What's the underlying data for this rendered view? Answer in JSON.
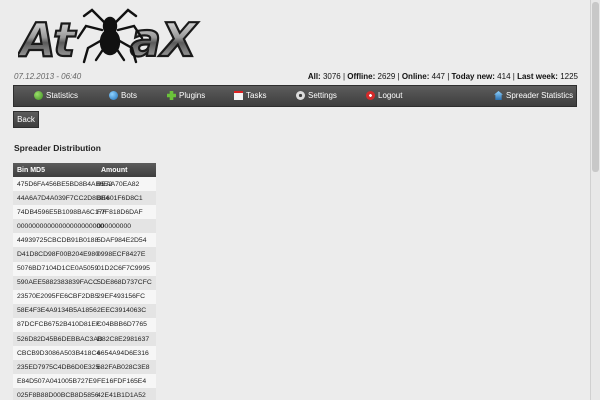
{
  "header": {
    "logo_text": "AtmaX",
    "date": "07.12.2013 - 06:40",
    "stats": {
      "all_label": "All:",
      "all_value": "3076",
      "offline_label": "Offline:",
      "offline_value": "2629",
      "online_label": "Online:",
      "online_value": "447",
      "today_label": "Today new:",
      "today_value": "414",
      "week_label": "Last week:",
      "week_value": "1225"
    }
  },
  "nav": {
    "items": [
      {
        "label": "Statistics",
        "icon": "globe-icon"
      },
      {
        "label": "Bots",
        "icon": "bots-icon"
      },
      {
        "label": "Plugins",
        "icon": "puzzle-icon"
      },
      {
        "label": "Tasks",
        "icon": "calendar-icon"
      },
      {
        "label": "Settings",
        "icon": "gear-icon"
      },
      {
        "label": "Logout",
        "icon": "power-icon"
      },
      {
        "label": "Spreader Statistics",
        "icon": "house-icon"
      }
    ]
  },
  "back_label": "Back",
  "section_title": "Spreader Distribution",
  "table": {
    "headers": [
      "Bin MD5",
      "Amount"
    ],
    "rows": [
      [
        "475D6FA456BE5BD8B4AB6E2",
        "BEAA70EA82"
      ],
      [
        "44A6A7D4A039F7CC2D8DB4",
        "BE601F6D8C1"
      ],
      [
        "74DB4596E5B1098BA6C17F",
        "F7F818D6DAF"
      ],
      [
        "00000000000000000000000",
        "000000000"
      ],
      [
        "44939725CBCDB91B0188",
        "5DAF984E2D54"
      ],
      [
        "D41D8CD98F00B204E980",
        "0998ECF8427E"
      ],
      [
        "5076BD7104D1CE0A5059",
        "01D2C6F7C9995"
      ],
      [
        "590AEE5882383839FACC",
        "5DE868D737CFC"
      ],
      [
        "23570E2095FE6CBF2DB5",
        "29EF493156FC"
      ],
      [
        "58E4F3E4A9134B5A1856",
        "2EEC3914063C"
      ],
      [
        "87DCFCB6752B410D81EF",
        "C04BBB6D7765"
      ],
      [
        "526D82D45B6DEBBAC3AB",
        "D82C8E2981637"
      ],
      [
        "CBCB9D3086A503B418C4",
        "6654A94D6E316"
      ],
      [
        "235ED7975C4DB6D0E325",
        "682FAB028C3E8"
      ],
      [
        "E84D507A041005B727E9",
        "FE16FDF165E4"
      ],
      [
        "025F8B88D00BCB8D5856",
        "42E41B1D1A52"
      ]
    ]
  },
  "colors": {
    "nav_bg": "#4a4a4a",
    "page_bg": "#ececec"
  }
}
